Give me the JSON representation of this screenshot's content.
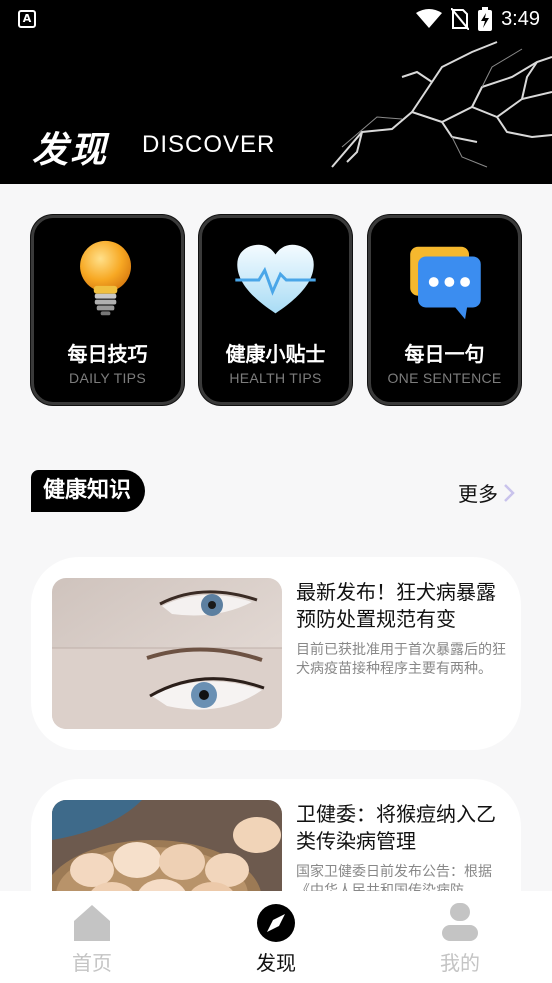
{
  "status_bar": {
    "app_icon_label": "A",
    "time": "3:49"
  },
  "header": {
    "title": "发现",
    "subtitle": "DISCOVER"
  },
  "categories": [
    {
      "title": "每日技巧",
      "subtitle": "DAILY TIPS",
      "icon": "lightbulb-icon"
    },
    {
      "title": "健康小贴士",
      "subtitle": "HEALTH TIPS",
      "icon": "heart-pulse-icon"
    },
    {
      "title": "每日一句",
      "subtitle": "ONE SENTENCE",
      "icon": "chat-bubble-icon"
    }
  ],
  "section": {
    "title": "健康知识",
    "more_label": "更多"
  },
  "articles": [
    {
      "title": "最新发布！狂犬病暴露预防处置规范有变",
      "description": "目前已获批准用于首次暴露后的狂犬病疫苗接种程序主要有两种。",
      "image": "eyes-photo"
    },
    {
      "title": "卫健委：将猴痘纳入乙类传染病管理",
      "description": "国家卫健委日前发布公告：根据《中华人民共和国传染病防",
      "image": "eggs-photo"
    }
  ],
  "bottom_nav": [
    {
      "label": "首页",
      "icon": "home-icon",
      "active": false
    },
    {
      "label": "发现",
      "icon": "compass-icon",
      "active": true
    },
    {
      "label": "我的",
      "icon": "user-icon",
      "active": false
    }
  ],
  "colors": {
    "accent": "#000000",
    "inactive": "#c4c4c4",
    "background": "#f7f7f8",
    "more_arrow": "#c9c3ec"
  }
}
